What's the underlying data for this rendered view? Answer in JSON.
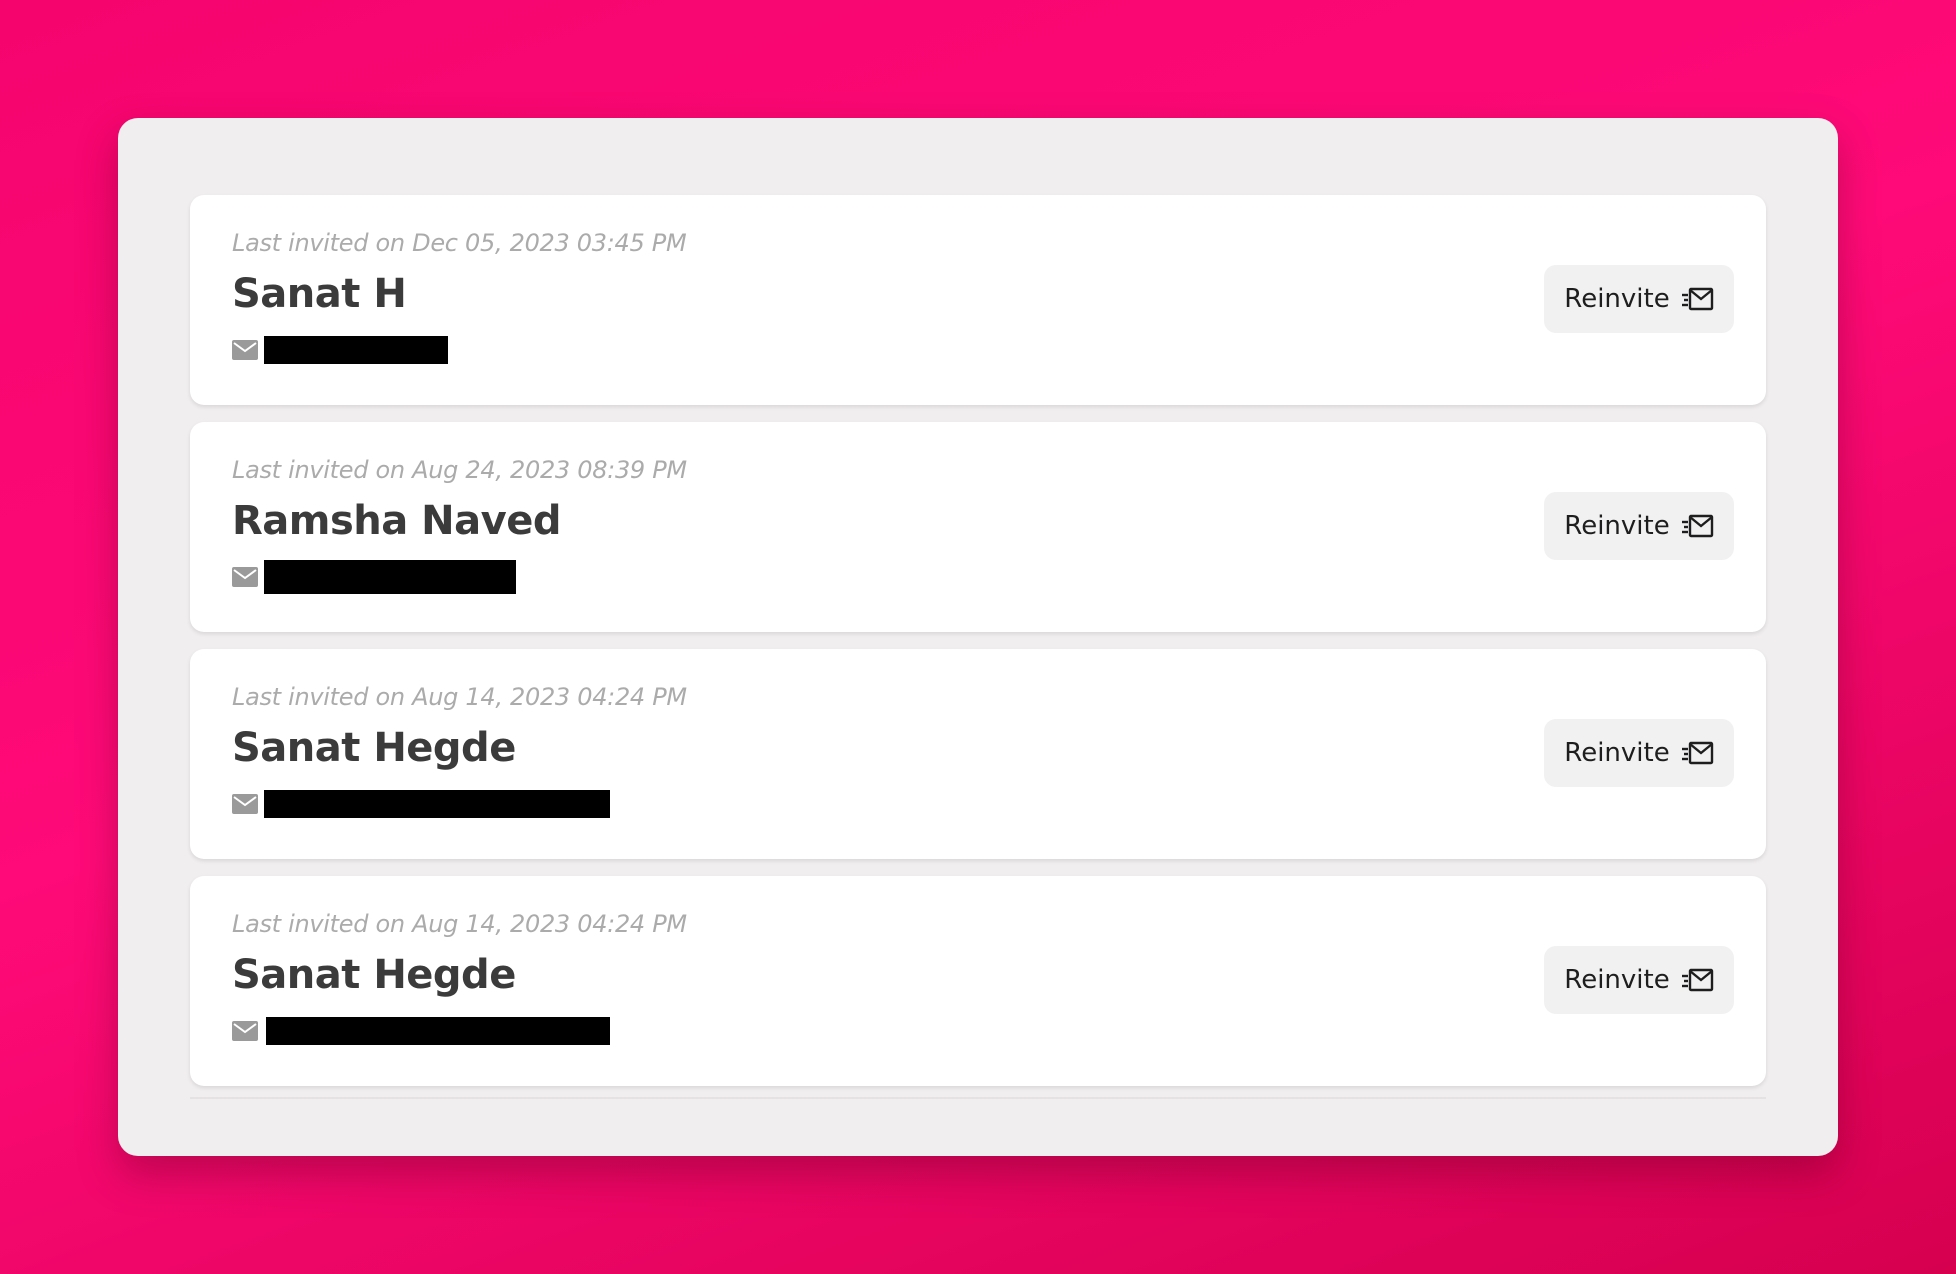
{
  "invites": [
    {
      "last_invited": "Last invited on Dec 05, 2023 03:45 PM",
      "name": "Sanat H",
      "email_redacted": true,
      "reinvite_label": "Reinvite"
    },
    {
      "last_invited": "Last invited on Aug 24, 2023 08:39 PM",
      "name": "Ramsha Naved",
      "email_redacted": true,
      "reinvite_label": "Reinvite"
    },
    {
      "last_invited": "Last invited on Aug 14, 2023 04:24 PM",
      "name": "Sanat Hegde",
      "email_redacted": true,
      "reinvite_label": "Reinvite"
    },
    {
      "last_invited": "Last invited on Aug 14, 2023 04:24 PM",
      "name": "Sanat Hegde",
      "email_redacted": true,
      "reinvite_label": "Reinvite"
    }
  ],
  "icons": {
    "email": "mail-icon",
    "reinvite": "send-mail-icon"
  },
  "colors": {
    "background_pink": "#ff0a78",
    "panel": "#f1eeef",
    "card": "#ffffff",
    "button": "#f1f1f2"
  }
}
